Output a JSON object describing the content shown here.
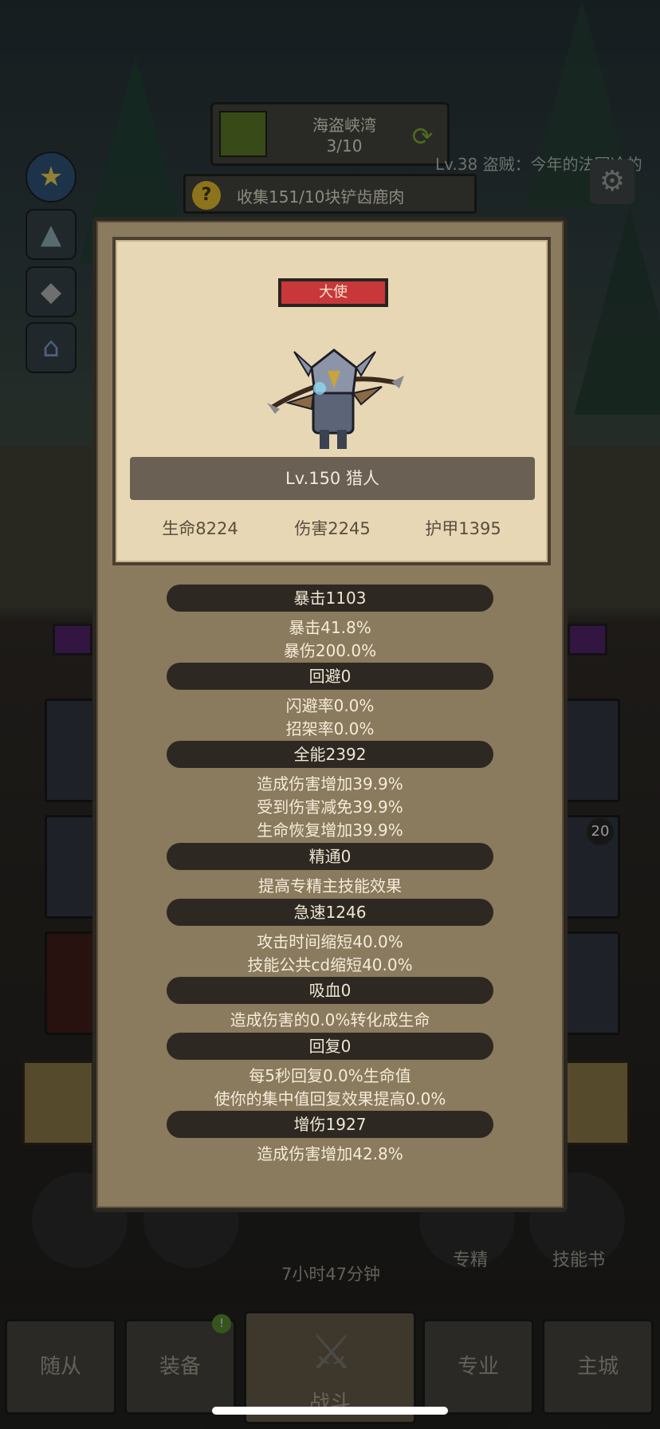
{
  "background": {
    "map_card": {
      "name": "海盗峡湾",
      "progress": "3/10"
    },
    "quest": {
      "text": "收集151/10块铲齿鹿肉"
    },
    "chat_line": "Lv.38 盗贼：今年的法国冷的",
    "slot_count": "20",
    "round_buttons": {
      "specialization": "专精",
      "skill_book": "技能书"
    },
    "timer": "7小时47分钟",
    "nav": {
      "followers": "随从",
      "equipment": "装备",
      "battle": "战斗",
      "profession": "专业",
      "main_city": "主城",
      "notify_badge": "!"
    }
  },
  "hero": {
    "rank": "大使",
    "level_class": "Lv.150 猎人",
    "hp": "生命8224",
    "damage": "伤害2245",
    "armor": "护甲1395"
  },
  "stats": [
    {
      "header": "暴击1103",
      "lines": [
        "暴击41.8%",
        "暴伤200.0%"
      ]
    },
    {
      "header": "回避0",
      "lines": [
        "闪避率0.0%",
        "招架率0.0%"
      ]
    },
    {
      "header": "全能2392",
      "lines": [
        "造成伤害增加39.9%",
        "受到伤害减免39.9%",
        "生命恢复增加39.9%"
      ]
    },
    {
      "header": "精通0",
      "lines": [
        "提高专精主技能效果"
      ]
    },
    {
      "header": "急速1246",
      "lines": [
        "攻击时间缩短40.0%",
        "技能公共cd缩短40.0%"
      ]
    },
    {
      "header": "吸血0",
      "lines": [
        "造成伤害的0.0%转化成生命"
      ]
    },
    {
      "header": "回复0",
      "lines": [
        "每5秒回复0.0%生命值",
        "使你的集中值回复效果提高0.0%"
      ]
    },
    {
      "header": "增伤1927",
      "lines": [
        "造成伤害增加42.8%"
      ]
    }
  ],
  "colors": {
    "panel": "#8a7a5e",
    "card": "#e7d7b5",
    "rank_badge": "#c8383a",
    "stat_header": "#2d2822"
  }
}
